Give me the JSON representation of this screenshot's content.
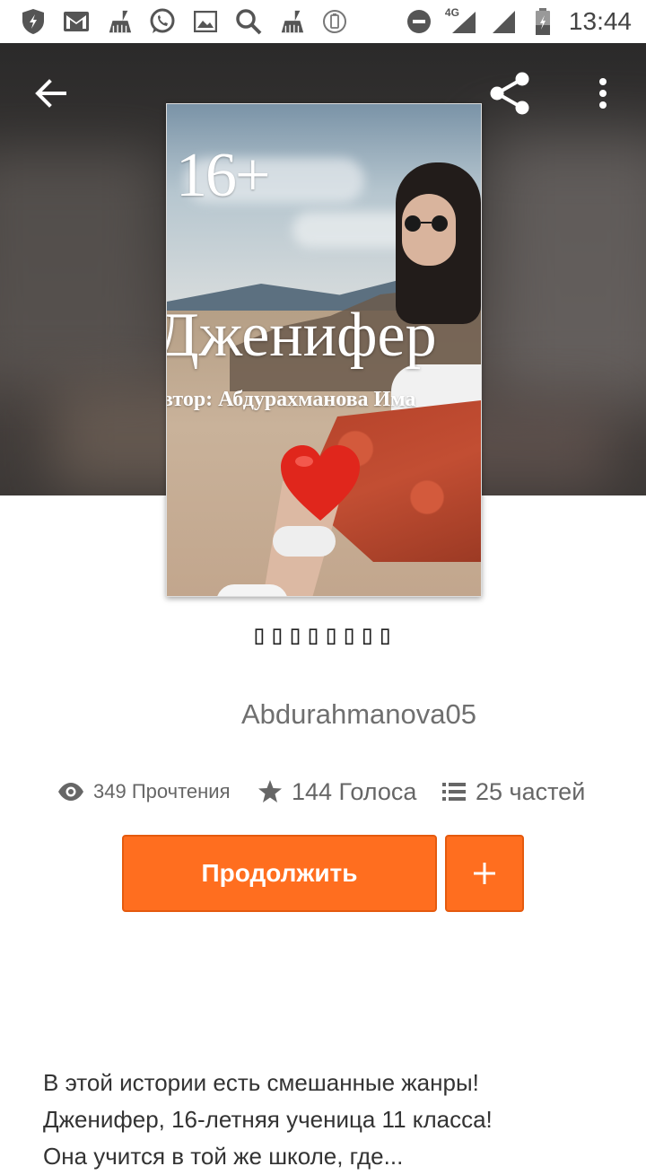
{
  "status_bar": {
    "time": "13:44",
    "network": "4G",
    "icons": [
      "shield-icon",
      "mail-icon",
      "broom-icon",
      "whatsapp-icon",
      "gallery-icon",
      "search-icon",
      "broom-icon",
      "battery-saver-icon",
      "do-not-disturb-icon",
      "signal-icon",
      "signal-icon",
      "battery-icon"
    ]
  },
  "toolbar": {
    "back_icon": "arrow-left-icon",
    "share_icon": "share-icon",
    "more_icon": "more-vertical-icon"
  },
  "cover": {
    "age_rating": "16+",
    "title": "Дженифер",
    "author_line": "втор: Абдурахманова Има"
  },
  "story": {
    "title": "▯▯▯▯▯▯▯▯",
    "author": "Abdurahmanova05"
  },
  "stats": {
    "reads": "349 Прочтения",
    "votes": "144 Голоса",
    "parts": "25 частей"
  },
  "actions": {
    "continue_label": "Продолжить",
    "add_label": "+"
  },
  "description": {
    "line1": "В этой истории есть смешанные жанры!",
    "line2": "Дженифер, 16-летняя ученица 11 класса!",
    "line3": "Она учится в той же школе, где..."
  },
  "colors": {
    "accent": "#ff6e1f",
    "accent_border": "#e55a0e",
    "text_primary": "#222222",
    "text_secondary": "#666666"
  }
}
